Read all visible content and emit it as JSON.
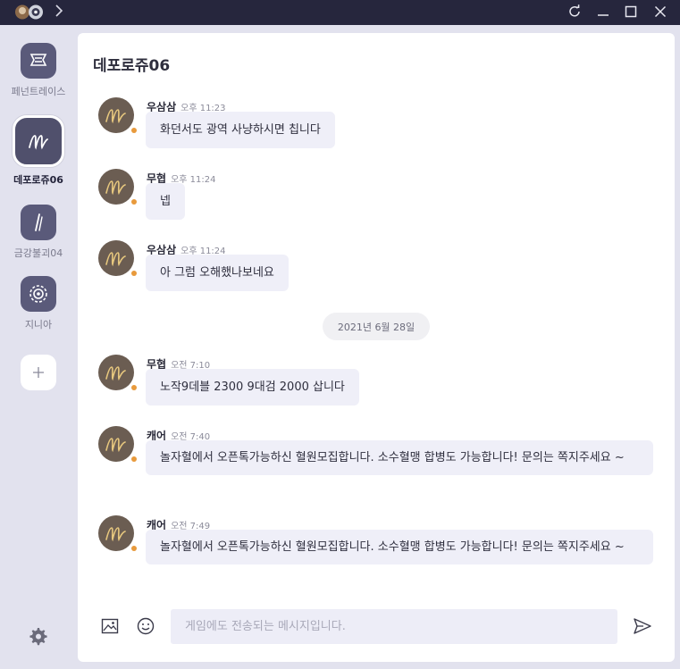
{
  "colors": {
    "titlebar": "#26263d",
    "sidebar_bg": "#e2e2ee",
    "bubble_bg": "#efeff8",
    "online_dot": "#e89a3c",
    "avatar_bg": "#6b5d52"
  },
  "titlebar": {
    "icons": [
      "user-avatar-icon",
      "chevron-right-icon",
      "refresh-icon",
      "minimize-icon",
      "maximize-icon",
      "close-icon"
    ]
  },
  "sidebar": {
    "servers": [
      {
        "label": "페넌트레이스",
        "icon": "pennant-race-icon",
        "active": false
      },
      {
        "label": "데포로쥬06",
        "icon": "guild-m-icon",
        "active": true
      },
      {
        "label": "금강불괴04",
        "icon": "sword-icon",
        "active": false
      },
      {
        "label": "지니아",
        "icon": "emblem-icon",
        "active": false
      }
    ],
    "add_icon": "plus-icon",
    "settings_icon": "gear-icon"
  },
  "room": {
    "title": "데포로쥬06"
  },
  "messages": [
    {
      "name": "우삼삼",
      "time": "오후 11:23",
      "text": "화던서도 광역 사냥하시면 칩니다"
    },
    {
      "name": "무협",
      "time": "오후 11:24",
      "text": "넵"
    },
    {
      "name": "우삼삼",
      "time": "오후 11:24",
      "text": "아 그럼 오해했나보네요"
    },
    {
      "name": "무협",
      "time": "오전 7:10",
      "text": "노작9데블 2300 9대검 2000 삽니다"
    },
    {
      "name": "캐어",
      "time": "오전 7:40",
      "text": "놀자혈에서 오픈톡가능하신 혈원모집합니다. 소수혈맹 합병도 가능합니다! 문의는 쪽지주세요 ~"
    },
    {
      "name": "캐어",
      "time": "오전 7:49",
      "text": "놀자혈에서 오픈톡가능하신 혈원모집합니다. 소수혈맹 합병도 가능합니다! 문의는 쪽지주세요 ~"
    }
  ],
  "date_divider": "2021년 6월 28일",
  "composer": {
    "placeholder": "게임에도 전송되는 메시지입니다.",
    "value": "",
    "icons": [
      "image-icon",
      "emoji-icon",
      "send-icon"
    ]
  }
}
